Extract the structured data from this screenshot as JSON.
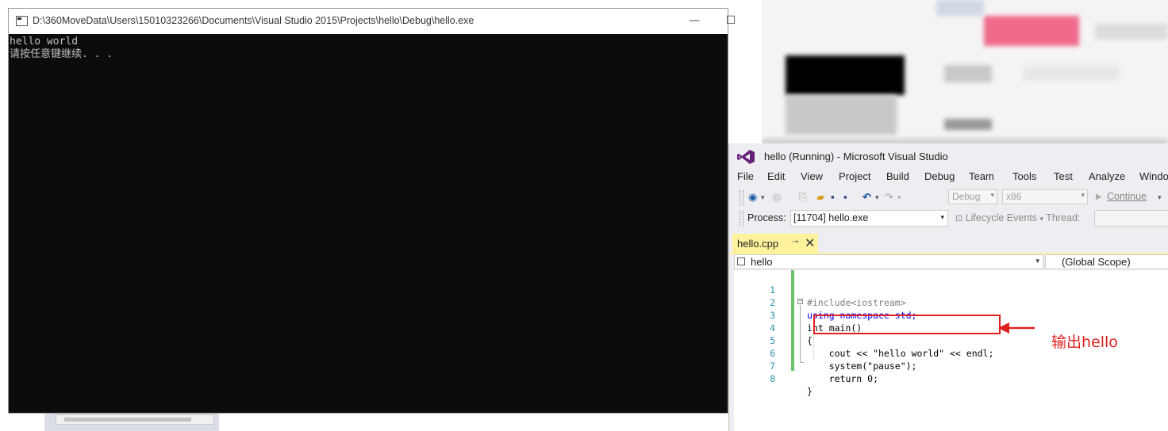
{
  "console": {
    "title": "D:\\360MoveData\\Users\\15010323266\\Documents\\Visual Studio 2015\\Projects\\hello\\Debug\\hello.exe",
    "minimize": "—",
    "maximize": "☐",
    "lines": [
      "hello world",
      "请按任意键继续. . ."
    ]
  },
  "vs": {
    "title": "hello (Running) - Microsoft Visual Studio",
    "menu": [
      "File",
      "Edit",
      "View",
      "Project",
      "Build",
      "Debug",
      "Team",
      "Tools",
      "Test",
      "Analyze",
      "Windo"
    ],
    "toolbar": {
      "config": "Debug",
      "platform": "x86",
      "continue": "Continue"
    },
    "process_label": "Process:",
    "process_value": "[11704] hello.exe",
    "lifecycle": "Lifecycle Events",
    "thread_label": "Thread:",
    "tab_name": "hello.cpp",
    "tab_pin": "⊸",
    "tab_close": "✕",
    "nav_left": "hello",
    "nav_right": "(Global Scope)",
    "code": [
      {
        "n": "1",
        "text": "#include<iostream>"
      },
      {
        "n": "2",
        "text": "using namespace std;"
      },
      {
        "n": "3",
        "text": "int main()"
      },
      {
        "n": "4",
        "text": "{"
      },
      {
        "n": "5",
        "text": "    cout << \"hello world\" << endl;"
      },
      {
        "n": "6",
        "text": "    system(\"pause\");"
      },
      {
        "n": "7",
        "text": "    return 0;"
      },
      {
        "n": "8",
        "text": "}"
      }
    ]
  },
  "annotation": {
    "text": "输出hello",
    "color": "#e02020"
  }
}
